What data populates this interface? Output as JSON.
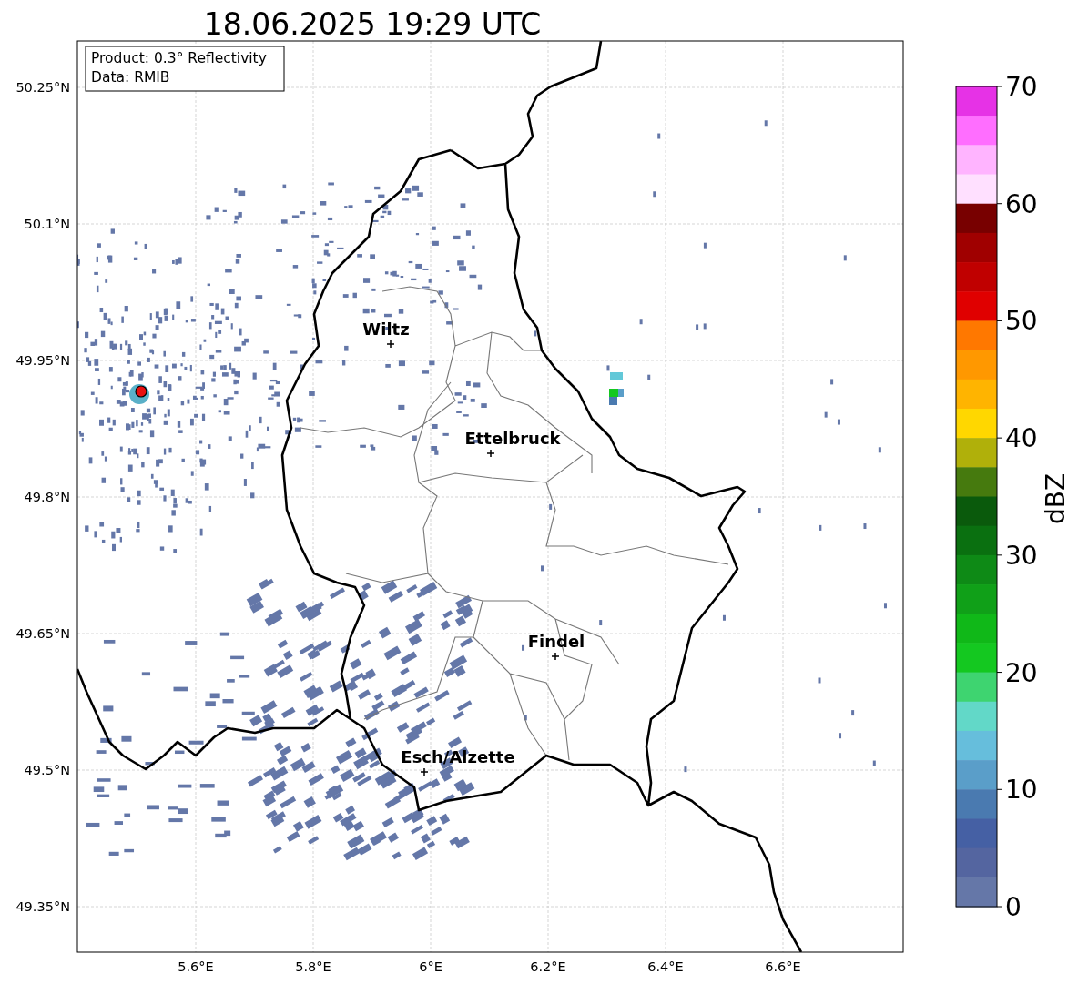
{
  "title": "18.06.2025 19:29 UTC",
  "info_box": {
    "lines": [
      "Product: 0.3° Reflectivity",
      "Data: RMIB"
    ]
  },
  "y_ticks": [
    "50.25°N",
    "50.1°N",
    "49.95°N",
    "49.8°N",
    "49.65°N",
    "49.5°N",
    "49.35°N"
  ],
  "x_ticks": [
    "5.6°E",
    "5.8°E",
    "6°E",
    "6.2°E",
    "6.4°E",
    "6.6°E"
  ],
  "cities": [
    {
      "name": "Wiltz"
    },
    {
      "name": "Ettelbruck"
    },
    {
      "name": "Findel"
    },
    {
      "name": "Esch/Alzette"
    }
  ],
  "colorbar": {
    "label": "dBZ",
    "ticks": [
      "70",
      "60",
      "50",
      "40",
      "30",
      "20",
      "10",
      "0"
    ],
    "bins": [
      {
        "color": "#e632e6"
      },
      {
        "color": "#ff6eff"
      },
      {
        "color": "#ffb4ff"
      },
      {
        "color": "#ffe0ff"
      },
      {
        "color": "#780000"
      },
      {
        "color": "#a00000"
      },
      {
        "color": "#c00000"
      },
      {
        "color": "#e00000"
      },
      {
        "color": "#ff7800"
      },
      {
        "color": "#ff9800"
      },
      {
        "color": "#ffb400"
      },
      {
        "color": "#ffd700"
      },
      {
        "color": "#b0b00a"
      },
      {
        "color": "#467a0e"
      },
      {
        "color": "#0a5a0c"
      },
      {
        "color": "#0a7010"
      },
      {
        "color": "#0e8a16"
      },
      {
        "color": "#10a018"
      },
      {
        "color": "#10b818"
      },
      {
        "color": "#14c820"
      },
      {
        "color": "#3ed470"
      },
      {
        "color": "#62d8c8"
      },
      {
        "color": "#66bedc"
      },
      {
        "color": "#5a9ec9"
      },
      {
        "color": "#4a7ab0"
      },
      {
        "color": "#4560a4"
      },
      {
        "color": "#5465a0"
      },
      {
        "color": "#6577a8"
      }
    ]
  }
}
